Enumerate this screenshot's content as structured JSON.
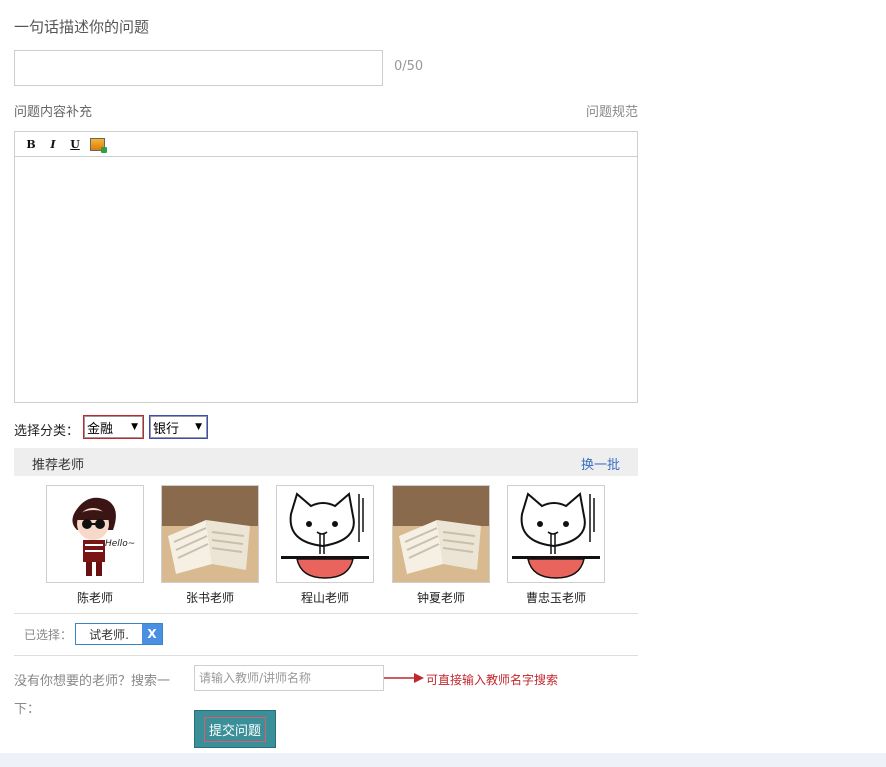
{
  "question": {
    "title_label": "一句话描述你的问题",
    "title_value": "",
    "counter": "0/50",
    "supplement_label": "问题内容补充",
    "rules_link": "问题规范"
  },
  "editor": {
    "toolbar": {
      "bold": "B",
      "italic": "I",
      "underline": "U",
      "image_icon": "insert-image-icon"
    },
    "content": ""
  },
  "category": {
    "label": "选择分类：",
    "primary": "金融",
    "secondary": "银行",
    "dropdown_icon": "triangle-down"
  },
  "recommended": {
    "title": "推荐老师",
    "swap_label": "换一批",
    "teachers": [
      {
        "name": "陈老师",
        "photo": "cartoon-girl-sunglasses"
      },
      {
        "name": "张书老师",
        "photo": "open-book"
      },
      {
        "name": "程山老师",
        "photo": "cartoon-cat-noodles"
      },
      {
        "name": "钟夏老师",
        "photo": "open-book"
      },
      {
        "name": "曹忠玉老师",
        "photo": "cartoon-cat-noodles"
      }
    ],
    "photo_text": {
      "hello": "Hello~"
    }
  },
  "selected": {
    "label": "已选择：",
    "teacher": "试老师.",
    "remove_label": "X"
  },
  "search": {
    "prompt": "没有你想要的老师？搜索一下：",
    "placeholder": "请输入教师/讲师名称",
    "value": "",
    "hint": "可直接输入教师名字搜索"
  },
  "submit_label": "提交问题",
  "colors": {
    "accent_blue": "#3a6fc4",
    "hint_red": "#c1272d",
    "submit_bg": "#3a8f98",
    "tag_x_bg": "#4a90e2"
  }
}
